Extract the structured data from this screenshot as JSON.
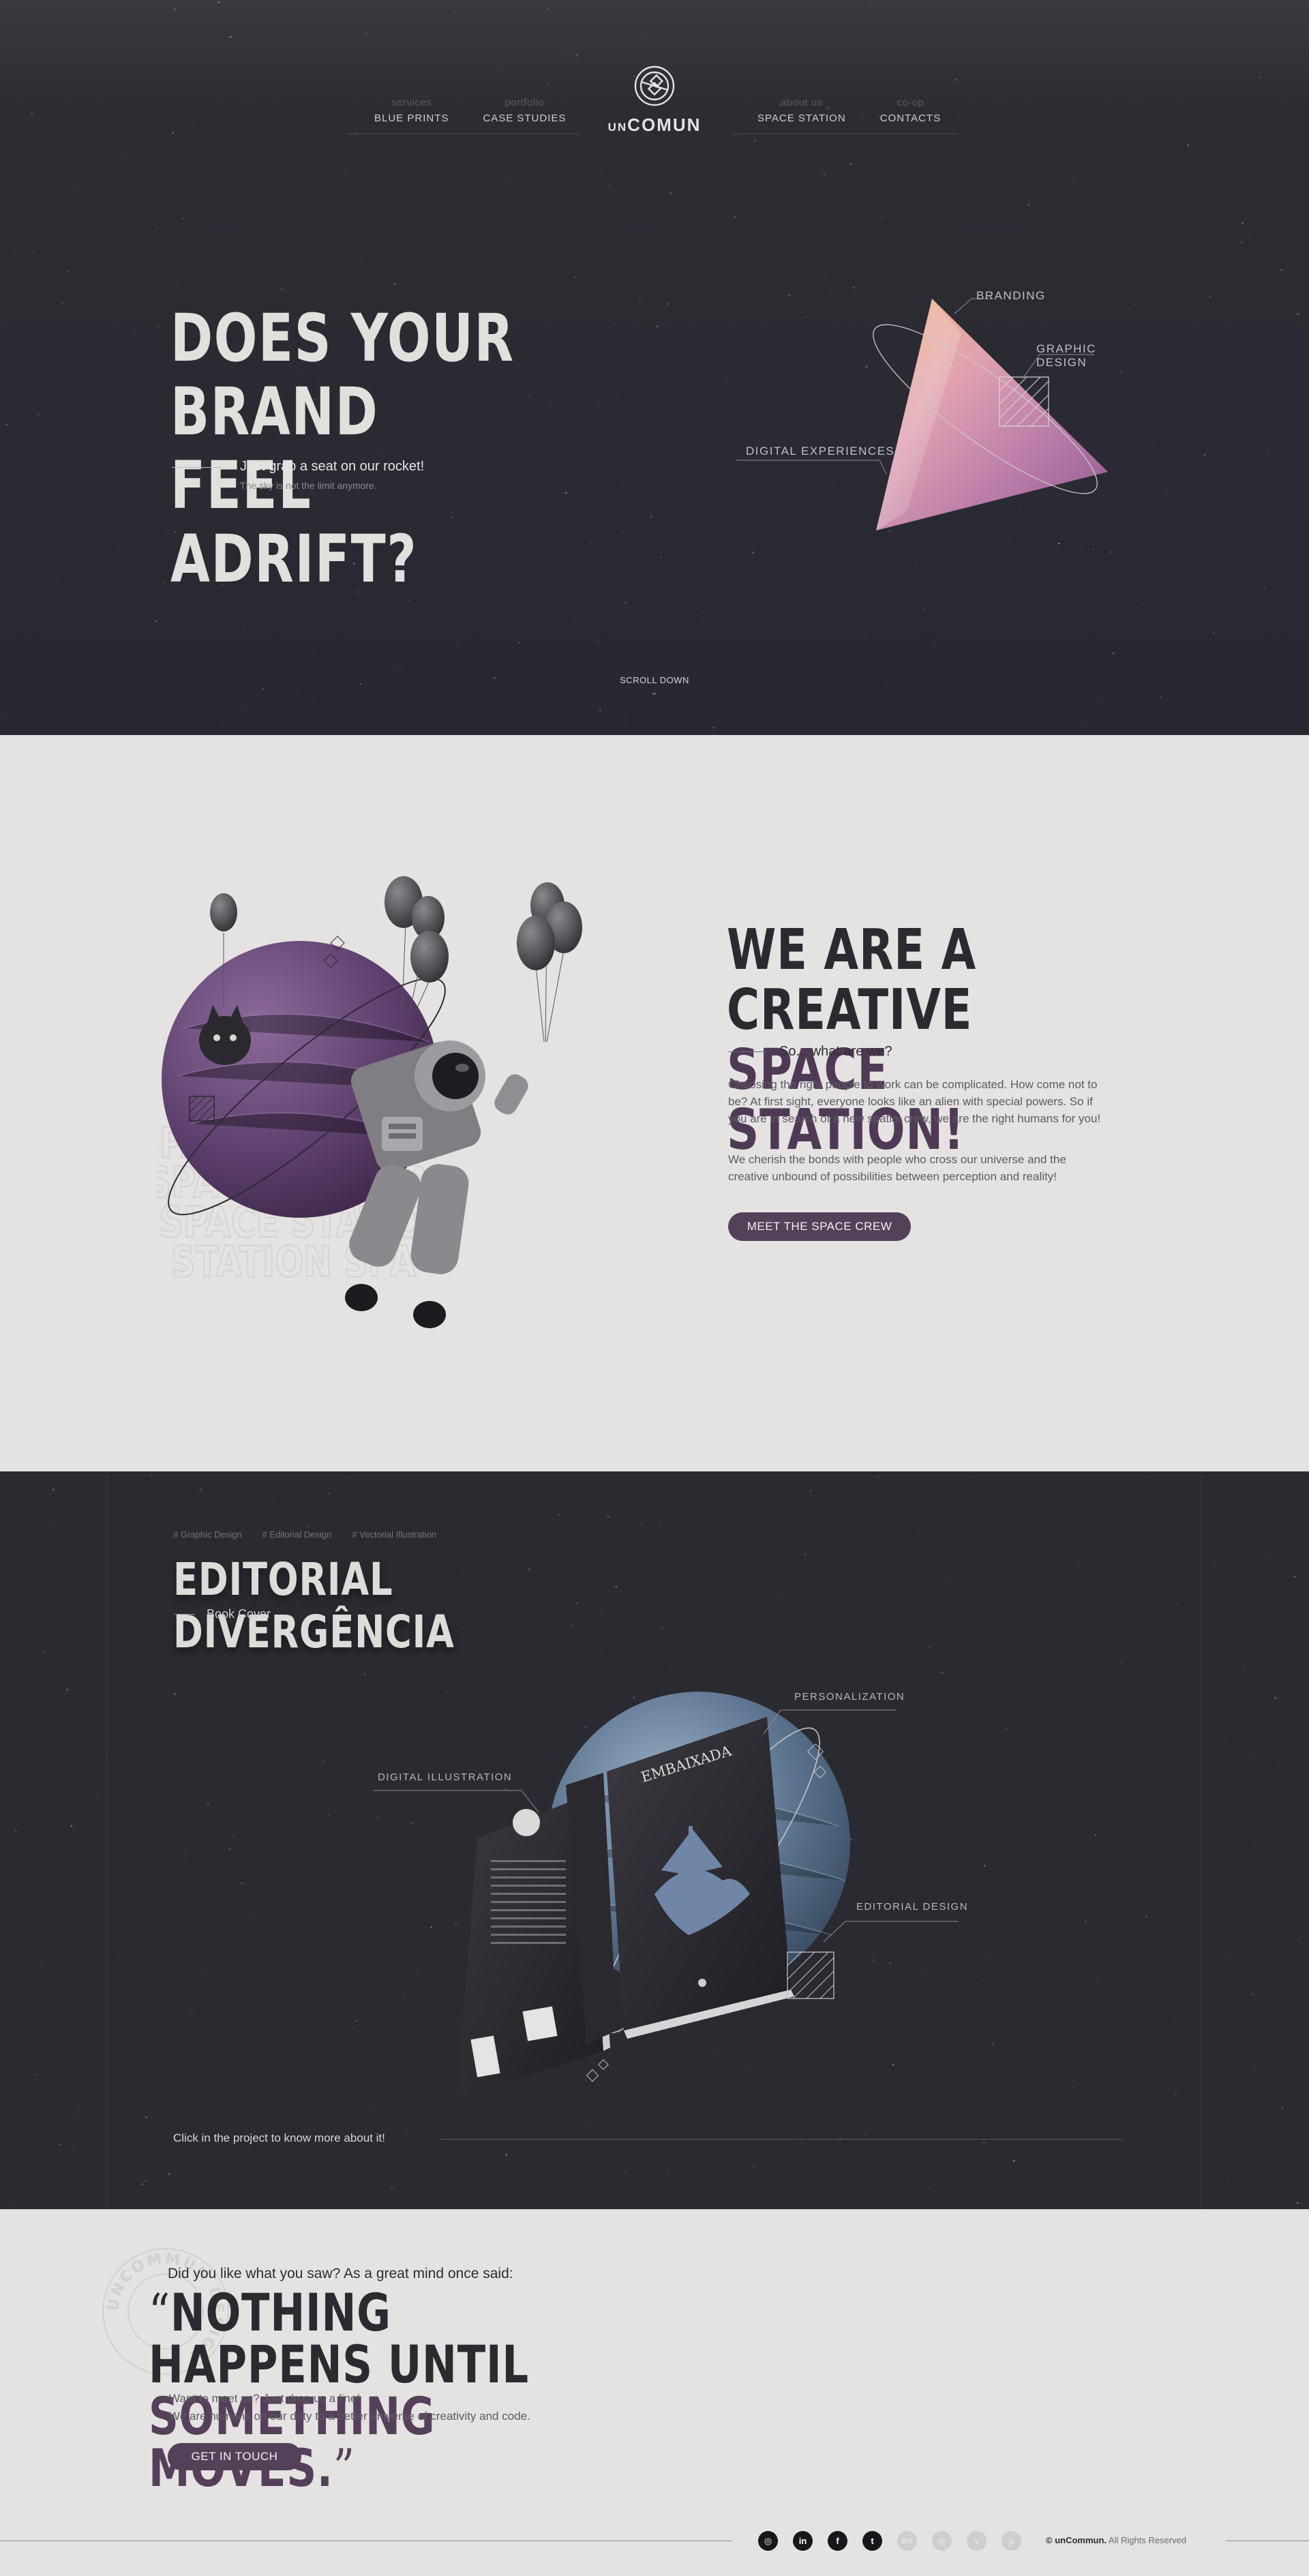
{
  "nav": {
    "left": [
      {
        "sub": "services",
        "label": "BLUE PRINTS"
      },
      {
        "sub": "portfolio",
        "label": "CASE STUDIES"
      }
    ],
    "right": [
      {
        "sub": "about us",
        "label": "SPACE STATION"
      },
      {
        "sub": "co-op",
        "label": "CONTACTS"
      }
    ],
    "logo_prefix": "UN",
    "logo_main": "COMUN"
  },
  "hero": {
    "title_line1": "DOES YOUR BRAND",
    "title_line2": "FEEL ADRIFT?",
    "subtitle": "Just grab a seat on our rocket!",
    "note": "The sky is not the limit anymore.",
    "labels": {
      "branding": "BRANDING",
      "graphic_design": "GRAPHIC DESIGN",
      "digital_experiences": "DIGITAL EXPERIENCES"
    },
    "scroll_down": "SCROLL DOWN",
    "scroll_chevron": "⌄"
  },
  "about": {
    "title_line1": "WE ARE A CREATIVE",
    "title_line2": "SPACE STATION!",
    "question": "So... what are we?",
    "paragraph1": "Choosing the right people to work can be complicated. How come not to be? At first sight, everyone looks like an alien with special powers. So if you are in search of a new spatial crew, we are the right humans for you!",
    "paragraph2": "We cherish the bonds with people who cross our universe and the creative unbound of possibilities between perception and reality!",
    "button": "MEET THE SPACE CREW",
    "watermark_lines": [
      "SPACE STATION",
      "SPACE STATION",
      "SPACE STATION",
      "STATION SPA"
    ]
  },
  "project": {
    "tags": [
      "# Graphic Design",
      "# Editorial Design",
      "# Vectorial Illustration"
    ],
    "title": "EDITORIAL DIVERGÊNCIA",
    "subtitle": "Book Cover",
    "labels": {
      "personalization": "PERSONALIZATION",
      "digital_illustration": "DIGITAL ILLUSTRATION",
      "editorial_design": "EDITORIAL DESIGN"
    },
    "book_title": "EMBAIXADA",
    "book_spine": "EMBAIXADA",
    "cta": "Click in the project to know more about it!"
  },
  "quote": {
    "intro": "Did you like what you saw? As a great mind once said:",
    "open_mark": "“",
    "line1": "NOTHING HAPPENS UNTIL",
    "line2": "SOMETHING MOVES.",
    "close_mark": "”",
    "paragraph1": "Want to meet us? Just drop us a line!",
    "paragraph2": "We are humans on our duty to a better universe of creativity and code.",
    "button": "GET IN TOUCH",
    "seal_text": "UNCOMMUN DESIGN"
  },
  "footer": {
    "socials": [
      {
        "icon": "instagram-icon",
        "glyph": "◎",
        "faded": false
      },
      {
        "icon": "linkedin-icon",
        "glyph": "in",
        "faded": false
      },
      {
        "icon": "facebook-icon",
        "glyph": "f",
        "faded": false
      },
      {
        "icon": "twitter-icon",
        "glyph": "t",
        "faded": false
      },
      {
        "icon": "behance-icon",
        "glyph": "Bē",
        "faded": true
      },
      {
        "icon": "dribbble-icon",
        "glyph": "◍",
        "faded": true
      },
      {
        "icon": "vimeo-icon",
        "glyph": "v",
        "faded": true
      },
      {
        "icon": "pinterest-icon",
        "glyph": "p",
        "faded": true
      }
    ],
    "brand": "© unCommun.",
    "rights": " All Rights Reserved"
  },
  "colors": {
    "dark_bg": "#2a2a31",
    "light_bg": "#e4e3e1",
    "accent_purple": "#55405a"
  }
}
